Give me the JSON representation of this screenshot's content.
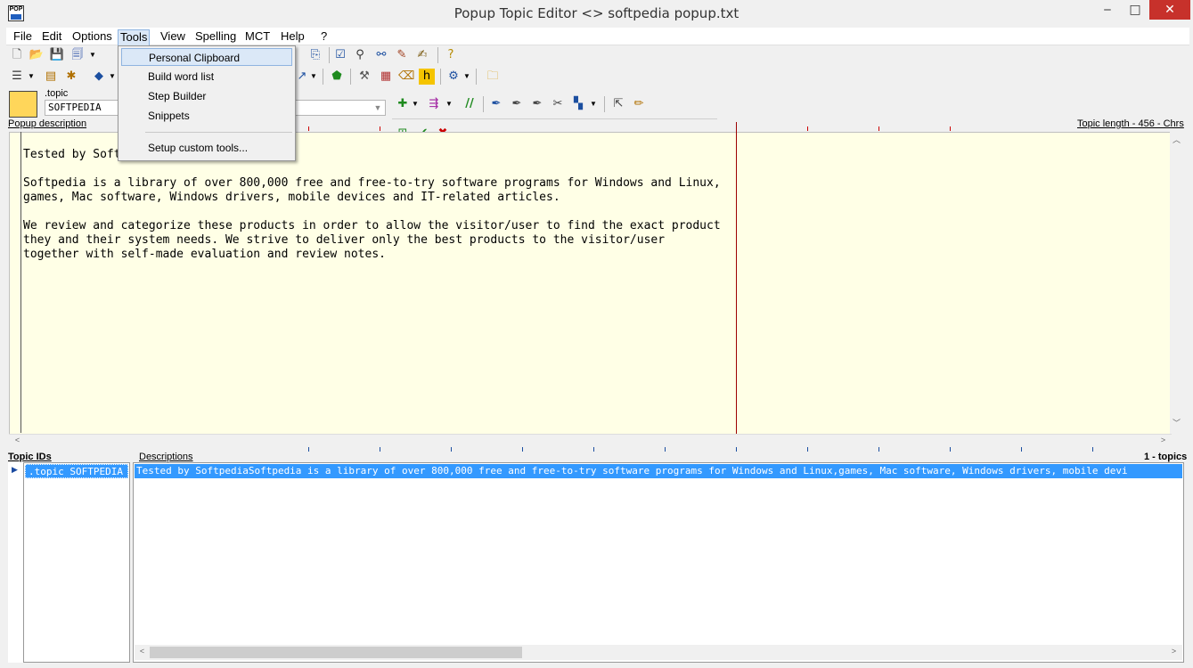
{
  "window": {
    "title": "Popup Topic Editor <> softpedia popup.txt",
    "app_icon_text": "POP",
    "minimize_icon": "minimize-icon",
    "maximize_icon": "maximize-icon",
    "close_icon": "close-icon",
    "minimize_glyph": "‒",
    "maximize_glyph": "□",
    "close_glyph": "✕"
  },
  "menubar": {
    "file": "File",
    "edit": "Edit",
    "options": "Options",
    "tools": "Tools",
    "view": "View",
    "spelling": "Spelling",
    "mct": "MCT",
    "help": "Help",
    "question": "?"
  },
  "tools_menu": {
    "items": [
      "Personal Clipboard",
      "Build word list",
      "Step Builder",
      "Snippets",
      "Setup custom tools..."
    ]
  },
  "topic": {
    "label": ".topic",
    "value": "SOFTPEDIA"
  },
  "editor": {
    "label": "Popup description",
    "length_text": "Topic length - 456 - Chrs",
    "text": "Tested by Softpedia\n\nSoftpedia is a library of over 800,000 free and free-to-try software programs for Windows and Linux,\ngames, Mac software, Windows drivers, mobile devices and IT-related articles.\n\nWe review and categorize these products in order to allow the visitor/user to find the exact product\nthey and their system needs. We strive to deliver only the best products to the visitor/user\ntogether with self-made evaluation and review notes."
  },
  "lists": {
    "ids_label": "Topic IDs",
    "descriptions_label": "Descriptions",
    "count": "1 - topics",
    "ids": [
      ".topic SOFTPEDIA"
    ],
    "descriptions": [
      "Tested by SoftpediaSoftpedia is a library of over 800,000 free and free-to-try software programs for Windows and Linux,games, Mac software, Windows drivers, mobile devi"
    ]
  },
  "colors": {
    "editor_bg": "#ffffe6",
    "selection": "#3399ff",
    "margin_line": "#9d0000",
    "close_button": "#c7312b"
  }
}
